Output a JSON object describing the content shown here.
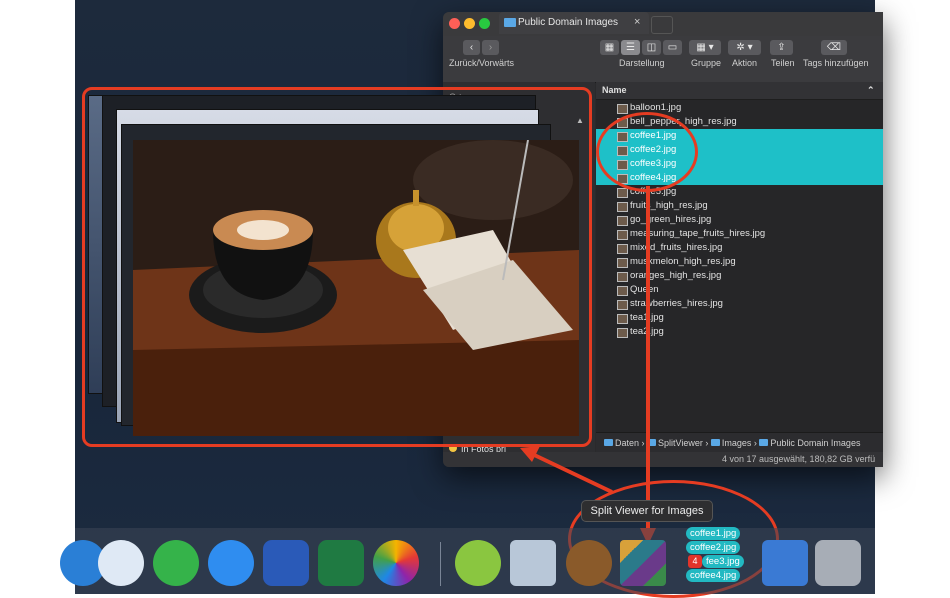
{
  "finder": {
    "tab_title": "Public Domain Images",
    "tab_close": "×",
    "nav_label": "Zurück/Vorwärts",
    "view_label": "Darstellung",
    "group_label": "Gruppe",
    "action_label": "Aktion",
    "share_label": "Teilen",
    "tags_label": "Tags hinzufügen",
    "sidebar_header": "Orte",
    "sidebar_item": "In Fotos pri",
    "column_name": "Name",
    "files": [
      {
        "name": "balloon1.jpg",
        "selected": false
      },
      {
        "name": "bell_pepper_high_res.jpg",
        "selected": false
      },
      {
        "name": "coffee1.jpg",
        "selected": true
      },
      {
        "name": "coffee2.jpg",
        "selected": true
      },
      {
        "name": "coffee3.jpg",
        "selected": true
      },
      {
        "name": "coffee4.jpg",
        "selected": true
      },
      {
        "name": "coffee5.jpg",
        "selected": false
      },
      {
        "name": "fruits_high_res.jpg",
        "selected": false
      },
      {
        "name": "go_green_hires.jpg",
        "selected": false
      },
      {
        "name": "measuring_tape_fruits_hires.jpg",
        "selected": false
      },
      {
        "name": "mixed_fruits_hires.jpg",
        "selected": false
      },
      {
        "name": "muskmelon_high_res.jpg",
        "selected": false
      },
      {
        "name": "oranges_high_res.jpg",
        "selected": false
      },
      {
        "name": "Queen",
        "selected": false
      },
      {
        "name": "strawberries_hires.jpg",
        "selected": false
      },
      {
        "name": "tea1.jpg",
        "selected": false
      },
      {
        "name": "tea2.jpg",
        "selected": false
      }
    ],
    "path": [
      "Daten",
      "SplitViewer",
      "Images",
      "Public Domain Images"
    ],
    "status": "4 von 17 ausgewählt, 180,82 GB verfü"
  },
  "dock": {
    "tooltip": "Split Viewer for Images",
    "drag_badge": "4",
    "drag_tags": [
      "coffee1.jpg",
      "coffee2.jpg",
      "fee3.jpg",
      "coffee4.jpg"
    ]
  },
  "colors": {
    "selection": "#1ec0c8",
    "annotation_red": "#e53c22"
  }
}
